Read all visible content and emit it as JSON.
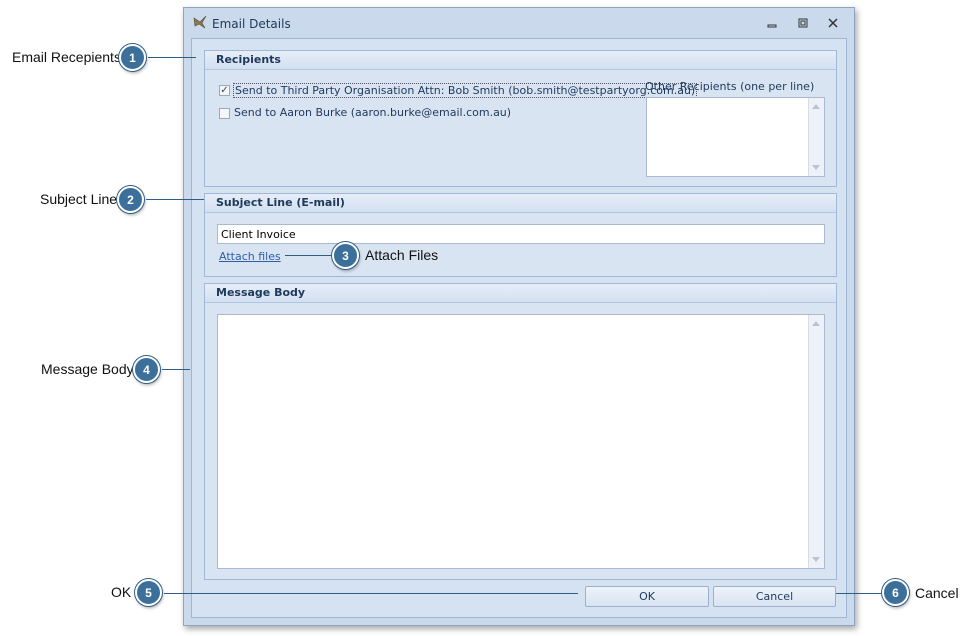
{
  "window": {
    "title": "Email Details",
    "icon": "email-bird-icon",
    "controls": [
      "minimize-icon",
      "restore-icon",
      "close-icon"
    ]
  },
  "recipients": {
    "header": "Recipients",
    "checkbox1": {
      "label": "Send to Third Party Organisation Attn: Bob Smith (bob.smith@testpartyorg.com.au)",
      "checked": true
    },
    "checkbox2": {
      "label": "Send to Aaron Burke (aaron.burke@email.com.au)",
      "checked": false
    },
    "other_label": "Other Recipients (one per line)",
    "other_value": ""
  },
  "subject": {
    "header": "Subject Line (E-mail)",
    "value": "Client Invoice",
    "attach_label": "Attach files"
  },
  "message": {
    "header": "Message Body",
    "value": ""
  },
  "buttons": {
    "ok": "OK",
    "cancel": "Cancel"
  },
  "callouts": [
    {
      "number": "1",
      "label": "Email Recepients"
    },
    {
      "number": "2",
      "label": "Subject Line"
    },
    {
      "number": "3",
      "label": "Attach Files"
    },
    {
      "number": "4",
      "label": "Message Body"
    },
    {
      "number": "5",
      "label": "OK"
    },
    {
      "number": "6",
      "label": "Cancel"
    }
  ],
  "colors": {
    "callout_badge": "#3d6f9b",
    "dialog_bg": "#cad9ec",
    "header_text": "#1e395b",
    "link": "#2e5ea7"
  }
}
